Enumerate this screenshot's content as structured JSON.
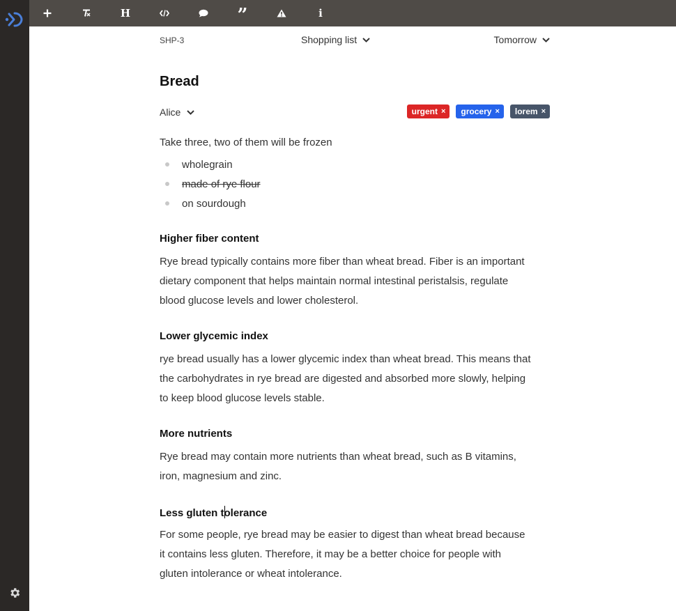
{
  "sidebar": {
    "logo_icon": "app-logo-icon",
    "settings_icon": "gear-icon",
    "accent": "#4a7fd8"
  },
  "toolbar": {
    "buttons": [
      {
        "icon": "plus-icon",
        "title": "Add"
      },
      {
        "icon": "clear-format-icon",
        "title": "Clear formatting"
      },
      {
        "icon": "heading-icon",
        "glyph": "H"
      },
      {
        "icon": "code-icon",
        "title": "Code"
      },
      {
        "icon": "comment-icon",
        "title": "Comment"
      },
      {
        "icon": "quote-icon",
        "glyph": "”"
      },
      {
        "icon": "warning-icon",
        "title": "Warning"
      },
      {
        "icon": "info-icon",
        "glyph": "i"
      }
    ]
  },
  "issue": {
    "id": "SHP-3",
    "list": "Shopping list",
    "due": "Tomorrow",
    "title": "Bread",
    "assignee": "Alice",
    "tags": [
      {
        "label": "urgent",
        "color": "#dc2626"
      },
      {
        "label": "grocery",
        "color": "#2563eb"
      },
      {
        "label": "lorem",
        "color": "#475569"
      }
    ],
    "description": "Take three, two of them will be frozen",
    "bullets": [
      {
        "text": "wholegrain",
        "done": false
      },
      {
        "text": "made of rye flour",
        "done": true
      },
      {
        "text": "on sourdough",
        "done": false
      }
    ],
    "sections": [
      {
        "heading": "Higher fiber content",
        "lines": [
          "Rye bread typically contains more fiber than wheat bread. Fiber is an important",
          "dietary component that helps maintain normal intestinal peristalsis, regulate",
          "blood glucose levels and lower cholesterol."
        ]
      },
      {
        "heading": "Lower glycemic index",
        "lines": [
          "rye bread usually has a lower glycemic index than wheat bread. This means that",
          "the carbohydrates in rye bread are digested and absorbed more slowly, helping",
          "to keep blood glucose levels stable."
        ]
      },
      {
        "heading": "More nutrients",
        "lines": [
          "Rye bread may contain more nutrients than wheat bread, such as B vitamins,",
          "iron, magnesium and zinc."
        ]
      },
      {
        "heading_before_caret": "Less gluten t",
        "heading_after_caret": "olerance",
        "lines": [
          "For some people, rye bread may be easier to digest than wheat bread because",
          "it contains less gluten. Therefore, it may be a better choice for people with",
          "gluten intolerance or wheat intolerance."
        ]
      }
    ]
  }
}
